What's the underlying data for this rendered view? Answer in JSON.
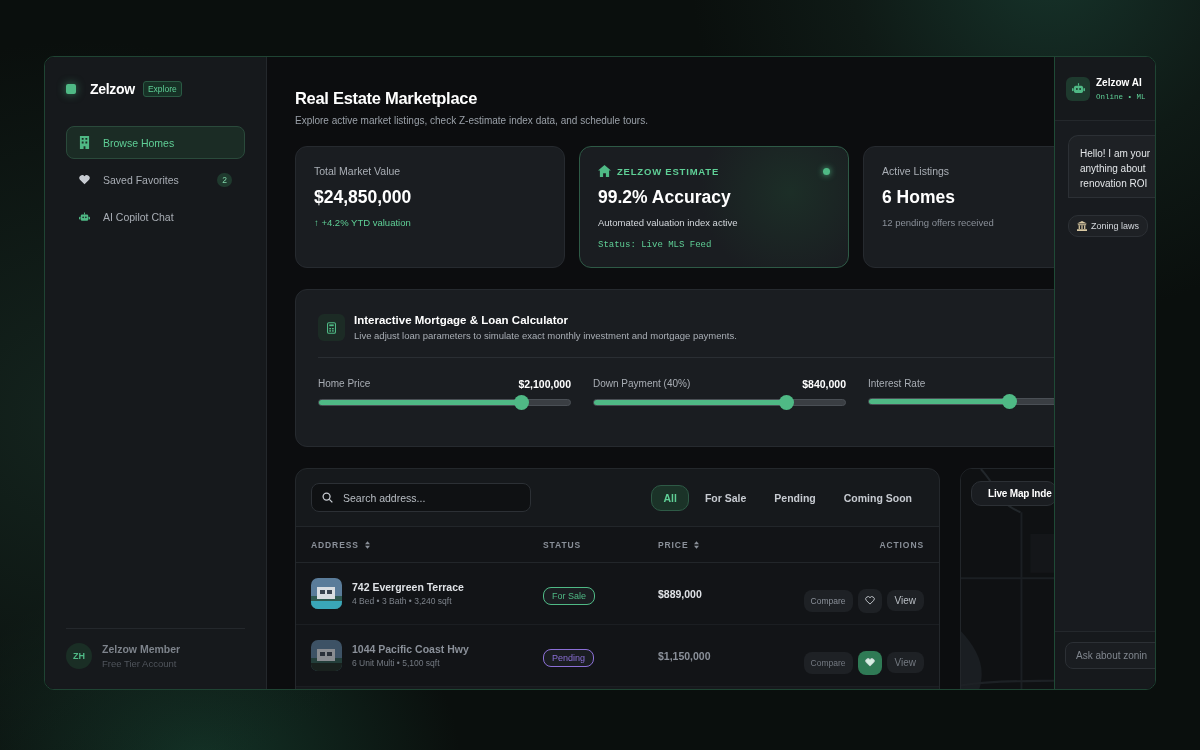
{
  "brand": {
    "name": "Zelzow",
    "badge": "Explore"
  },
  "nav": [
    {
      "label": "Browse Homes",
      "selected": true
    },
    {
      "label": "Saved Favorites",
      "selected": false,
      "count": "2"
    },
    {
      "label": "AI Copilot Chat",
      "selected": false
    }
  ],
  "user": {
    "initials": "ZH",
    "name": "Zelzow Member",
    "plan": "Free Tier Account"
  },
  "header": {
    "title": "Real Estate Marketplace",
    "subtitle": "Explore active market listings, check Z-estimate index data, and schedule tours."
  },
  "stats": [
    {
      "kind": "growth",
      "label": "Total Market Value",
      "value": "$24,850,000",
      "note": "↑ +4.2% YTD valuation"
    },
    {
      "kind": "estimate",
      "label": "ZELZOW ESTIMATE",
      "value": "99.2% Accuracy",
      "note": "Automated valuation index active",
      "status": "Status: Live MLS Feed"
    },
    {
      "kind": "count",
      "label": "Active Listings",
      "value": "6 Homes",
      "note": "12 pending offers received"
    }
  ],
  "calculator": {
    "title": "Interactive Mortgage & Loan Calculator",
    "subtitle": "Live adjust loan parameters to simulate exact monthly investment and mortgage payments.",
    "sliders": [
      {
        "label": "Home Price",
        "reading": "$2,100,000",
        "level": 0.81
      },
      {
        "label": "Down Payment (40%)",
        "reading": "$840,000",
        "level": 0.77
      },
      {
        "label": "Interest Rate",
        "level": 0.56
      }
    ]
  },
  "listings": {
    "search": {
      "placeholder": "Search address..."
    },
    "filters": [
      {
        "label": "All",
        "selected": true
      },
      {
        "label": "For Sale",
        "selected": false
      },
      {
        "label": "Pending",
        "selected": false
      },
      {
        "label": "Coming Soon",
        "selected": false
      }
    ],
    "columns": [
      {
        "label": "ADDRESS",
        "sortable": true
      },
      {
        "label": "STATUS",
        "sortable": false
      },
      {
        "label": "PRICE",
        "sortable": true
      },
      {
        "label": "ACTIONS",
        "sortable": false
      }
    ],
    "rows": [
      {
        "address": "742 Evergreen Terrace",
        "details": "4 Bed • 3 Bath • 3,240 sqft",
        "status": {
          "label": "For Sale",
          "color": "#4fb985"
        },
        "price": "$889,000",
        "compare": "Compare",
        "view": "View",
        "favorite": false,
        "dimmed": false
      },
      {
        "address": "1044 Pacific Coast Hwy",
        "details": "6 Unit Multi • 5,100 sqft",
        "status": {
          "label": "Pending",
          "color": "#8b6fd6"
        },
        "price": "$1,150,000",
        "compare": "Compare",
        "view": "View",
        "favorite": true,
        "dimmed": true
      }
    ]
  },
  "map": {
    "label": "Live Map Inde"
  },
  "chat": {
    "title": "Zelzow AI",
    "status": "Online • ML",
    "message_lines": [
      "Hello! I am your",
      "anything about",
      "renovation ROI"
    ],
    "chips": [
      {
        "label": "Zoning laws"
      }
    ],
    "input_placeholder": "Ask about zonin"
  }
}
